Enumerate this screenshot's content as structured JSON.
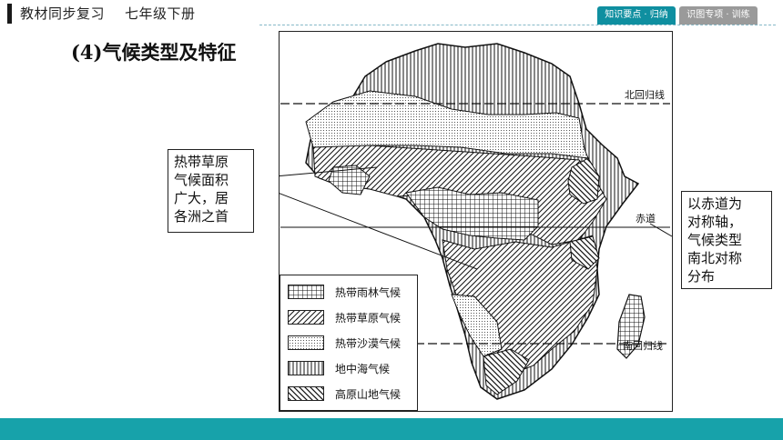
{
  "header": {
    "course": "教材同步复习",
    "grade": "七年级下册",
    "tabs": [
      {
        "label": "知识要点 · 归纳",
        "active": true
      },
      {
        "label": "识图专项 · 训练",
        "active": false
      }
    ]
  },
  "section": {
    "title": "(4)气候类型及特征"
  },
  "callouts": {
    "left": "热带草原\n气候面积\n广大，居\n各洲之首",
    "right": "以赤道为\n对称轴，\n气候类型\n南北对称\n分布"
  },
  "map": {
    "labels": {
      "tropic_cancer": "北回归线",
      "equator": "赤道",
      "tropic_capricorn": "南回归线"
    }
  },
  "legend": [
    {
      "label": "热带雨林气候",
      "pattern": "grid"
    },
    {
      "label": "热带草原气候",
      "pattern": "diagonal"
    },
    {
      "label": "热带沙漠气候",
      "pattern": "dots"
    },
    {
      "label": "地中海气候",
      "pattern": "vertical"
    },
    {
      "label": "高原山地气候",
      "pattern": "backdiag"
    }
  ],
  "colors": {
    "accent": "#17a2aa",
    "tab_active": "#0f8fa0",
    "tab_inactive": "#9a9a9a"
  }
}
